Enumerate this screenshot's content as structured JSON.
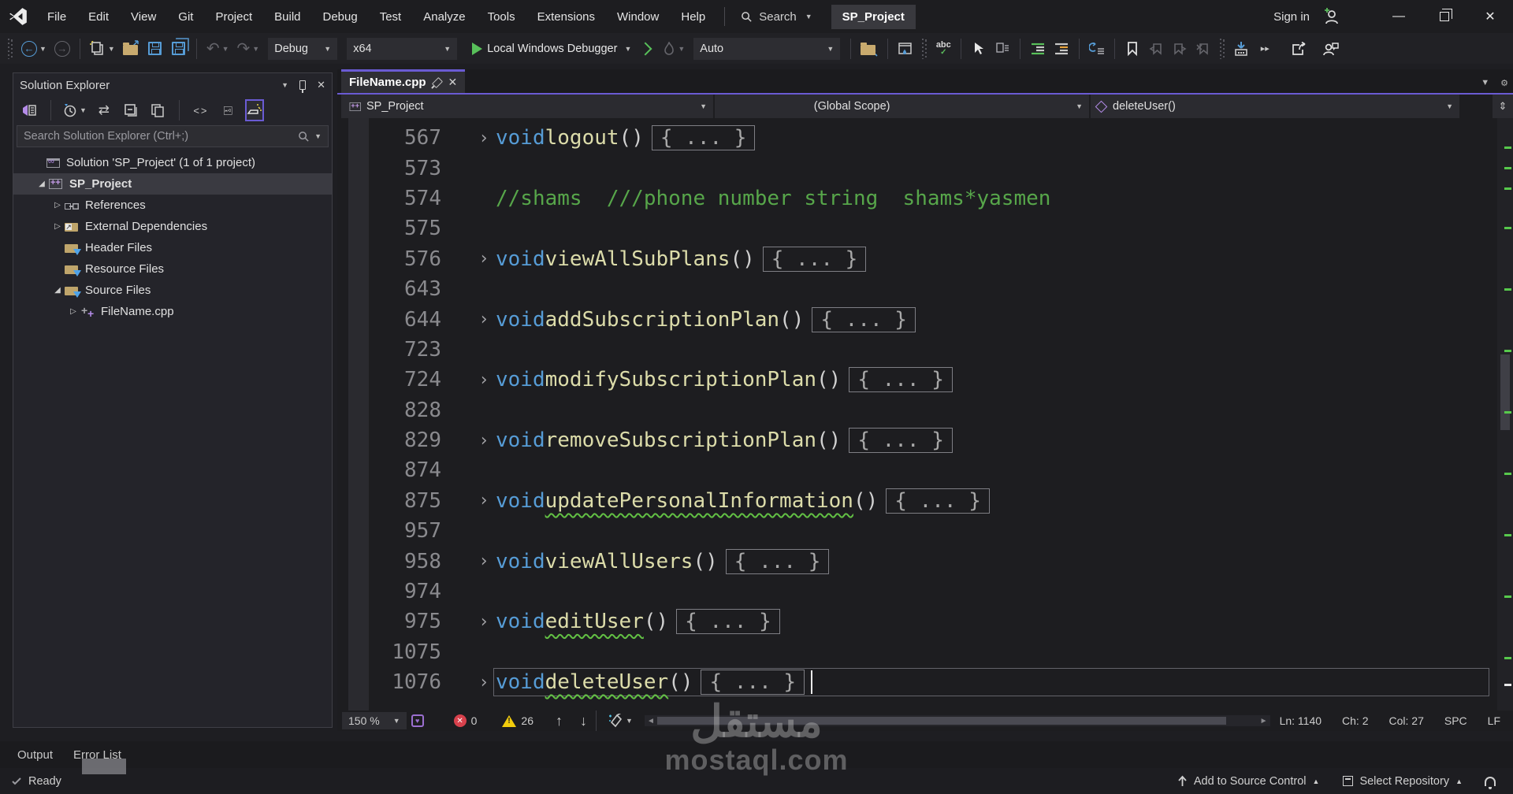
{
  "window": {
    "sign_in": "Sign in",
    "project_badge": "SP_Project",
    "search_label": "Search"
  },
  "menu": {
    "items": [
      "File",
      "Edit",
      "View",
      "Git",
      "Project",
      "Build",
      "Debug",
      "Test",
      "Analyze",
      "Tools",
      "Extensions",
      "Window",
      "Help"
    ]
  },
  "toolbar": {
    "configuration": "Debug",
    "platform": "x64",
    "debugger_label": "Local Windows Debugger",
    "watch_mode": "Auto",
    "spellcheck_label": "abc"
  },
  "solution_explorer": {
    "title": "Solution Explorer",
    "search_placeholder": "Search Solution Explorer (Ctrl+;)",
    "tree": [
      {
        "label": "Solution 'SP_Project' (1 of 1 project)",
        "icon": "solution",
        "indent": 0,
        "arrow": "expanded-root"
      },
      {
        "label": "SP_Project",
        "icon": "cpp-project",
        "indent": 1,
        "arrow": "expanded",
        "selected": true,
        "bold": true
      },
      {
        "label": "References",
        "icon": "references",
        "indent": 2,
        "arrow": "collapsed"
      },
      {
        "label": "External Dependencies",
        "icon": "external-dependencies",
        "indent": 2,
        "arrow": "collapsed"
      },
      {
        "label": "Header Files",
        "icon": "folder-filter",
        "indent": 2,
        "arrow": "none"
      },
      {
        "label": "Resource Files",
        "icon": "folder-filter",
        "indent": 2,
        "arrow": "none"
      },
      {
        "label": "Source Files",
        "icon": "folder-filter",
        "indent": 2,
        "arrow": "expanded"
      },
      {
        "label": "FileName.cpp",
        "icon": "cpp-file",
        "indent": 3,
        "arrow": "collapsed"
      }
    ]
  },
  "editor": {
    "tab_title": "FileName.cpp",
    "nav": {
      "project": "SP_Project",
      "scope": "(Global Scope)",
      "member": "deleteUser()"
    },
    "code": {
      "keyword": "void",
      "parens": "()",
      "collapsed_body": "{ ... }",
      "lines": [
        {
          "num": "567",
          "type": "func",
          "name": "logout",
          "squiggle": false
        },
        {
          "num": "573",
          "type": "blank"
        },
        {
          "num": "574",
          "type": "comment",
          "text": "//shams  ///phone number string  shams*yasmen"
        },
        {
          "num": "575",
          "type": "blank"
        },
        {
          "num": "576",
          "type": "func",
          "name": "viewAllSubPlans",
          "squiggle": false
        },
        {
          "num": "643",
          "type": "blank"
        },
        {
          "num": "644",
          "type": "func",
          "name": "addSubscriptionPlan",
          "squiggle": false
        },
        {
          "num": "723",
          "type": "blank"
        },
        {
          "num": "724",
          "type": "func",
          "name": "modifySubscriptionPlan",
          "squiggle": false
        },
        {
          "num": "828",
          "type": "blank"
        },
        {
          "num": "829",
          "type": "func",
          "name": "removeSubscriptionPlan",
          "squiggle": false
        },
        {
          "num": "874",
          "type": "blank"
        },
        {
          "num": "875",
          "type": "func",
          "name": "updatePersonalInformation",
          "squiggle": true
        },
        {
          "num": "957",
          "type": "blank"
        },
        {
          "num": "958",
          "type": "func",
          "name": "viewAllUsers",
          "squiggle": false
        },
        {
          "num": "974",
          "type": "blank"
        },
        {
          "num": "975",
          "type": "func",
          "name": "editUser",
          "squiggle": true
        },
        {
          "num": "1075",
          "type": "blank"
        },
        {
          "num": "1076",
          "type": "func",
          "name": "deleteUser",
          "squiggle": true,
          "current": true
        }
      ]
    },
    "status": {
      "zoom": "150 %",
      "errors": "0",
      "warnings": "26",
      "line": "Ln: 1140",
      "char": "Ch: 2",
      "column": "Col: 27",
      "whitespace": "SPC",
      "line_ending": "LF"
    }
  },
  "bottom_panel": {
    "tabs": [
      "Output",
      "Error List"
    ]
  },
  "status_bar": {
    "ready": "Ready",
    "add_source_control": "Add to Source Control",
    "select_repository": "Select Repository"
  },
  "watermark": {
    "arabic": "مستقل",
    "latin": "mostaql.com"
  },
  "icons": {
    "back": "back-icon",
    "forward": "forward-icon",
    "new-file": "new-file-icon",
    "open-folder": "open-folder-icon",
    "save": "save-icon",
    "save-all": "save-all-icon",
    "undo": "undo-icon",
    "redo": "redo-icon",
    "run": "start-debug-icon",
    "run-no-debug": "start-without-debugging-icon",
    "hot-reload": "hot-reload-flame-icon",
    "find-in-files": "find-in-files-icon",
    "spellcheck": "abc-spellcheck-icon",
    "bookmark": "bookmark-icon",
    "feedback": "feedback-person-icon",
    "share": "share-icon",
    "bell": "notifications-bell-icon",
    "pin": "pin-icon",
    "close": "close-icon",
    "search": "search-icon",
    "cube": "member-cube-icon"
  },
  "colors": {
    "accent_purple": "#6a5bd3",
    "keyword_blue": "#569cd6",
    "function_yellow": "#dcdcaa",
    "comment_green": "#57a64a",
    "squiggle_green": "#62c044",
    "error_red": "#d8414c",
    "warning_yellow": "#f2cc0c",
    "editor_bg": "#1d1d20"
  }
}
